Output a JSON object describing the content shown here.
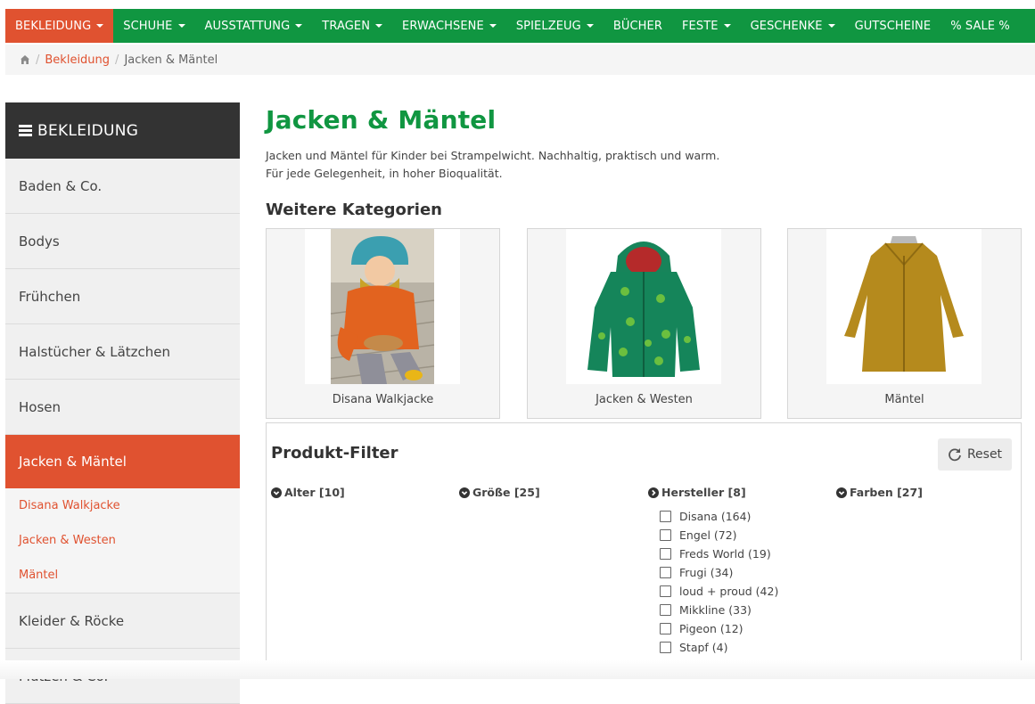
{
  "nav": {
    "items": [
      {
        "label": "BEKLEIDUNG",
        "caret": true,
        "active": true
      },
      {
        "label": "SCHUHE",
        "caret": true
      },
      {
        "label": "AUSSTATTUNG",
        "caret": true
      },
      {
        "label": "TRAGEN",
        "caret": true
      },
      {
        "label": "ERWACHSENE",
        "caret": true
      },
      {
        "label": "SPIELZEUG",
        "caret": true
      },
      {
        "label": "BÜCHER",
        "caret": false
      },
      {
        "label": "FESTE",
        "caret": true
      },
      {
        "label": "GESCHENKE",
        "caret": true
      },
      {
        "label": "GUTSCHEINE",
        "caret": false
      },
      {
        "label": "% SALE %",
        "caret": false
      }
    ],
    "colors": {
      "bar": "#109641",
      "active": "#e05230"
    }
  },
  "breadcrumb": {
    "home_icon": "home-icon",
    "link": "Bekleidung",
    "current": "Jacken & Mäntel"
  },
  "sidebar": {
    "title": "BEKLEIDUNG",
    "items_before": [
      {
        "label": "Baden & Co."
      },
      {
        "label": "Bodys"
      },
      {
        "label": "Frühchen"
      },
      {
        "label": "Halstücher & Lätzchen"
      },
      {
        "label": "Hosen"
      }
    ],
    "active": {
      "label": "Jacken & Mäntel"
    },
    "subitems": [
      {
        "label": "Disana Walkjacke"
      },
      {
        "label": "Jacken & Westen"
      },
      {
        "label": "Mäntel"
      }
    ],
    "items_after": [
      {
        "label": "Kleider & Röcke"
      },
      {
        "label": "Mützen & Co."
      }
    ]
  },
  "main": {
    "title": "Jacken & Mäntel",
    "intro_line1": "Jacken und Mäntel für Kinder bei Strampelwicht. Nachhaltig, praktisch und warm.",
    "intro_line2": "Für jede Gelegenheit, in hoher Bioqualität.",
    "more_categories": "Weitere Kategorien",
    "cards": [
      {
        "label": "Disana Walkjacke"
      },
      {
        "label": "Jacken & Westen"
      },
      {
        "label": "Mäntel"
      }
    ]
  },
  "filter": {
    "title": "Produkt-Filter",
    "reset_label": "Reset",
    "groups": [
      {
        "label": "Alter [10]"
      },
      {
        "label": "Größe [25]"
      },
      {
        "label": "Hersteller [8]"
      },
      {
        "label": "Farben [27]"
      }
    ],
    "manufacturer_options": [
      {
        "label": "Disana (164)"
      },
      {
        "label": "Engel (72)"
      },
      {
        "label": "Freds World (19)"
      },
      {
        "label": "Frugi (34)"
      },
      {
        "label": "loud + proud (42)"
      },
      {
        "label": "Mikkline (33)"
      },
      {
        "label": "Pigeon (12)"
      },
      {
        "label": "Stapf (4)"
      }
    ]
  }
}
